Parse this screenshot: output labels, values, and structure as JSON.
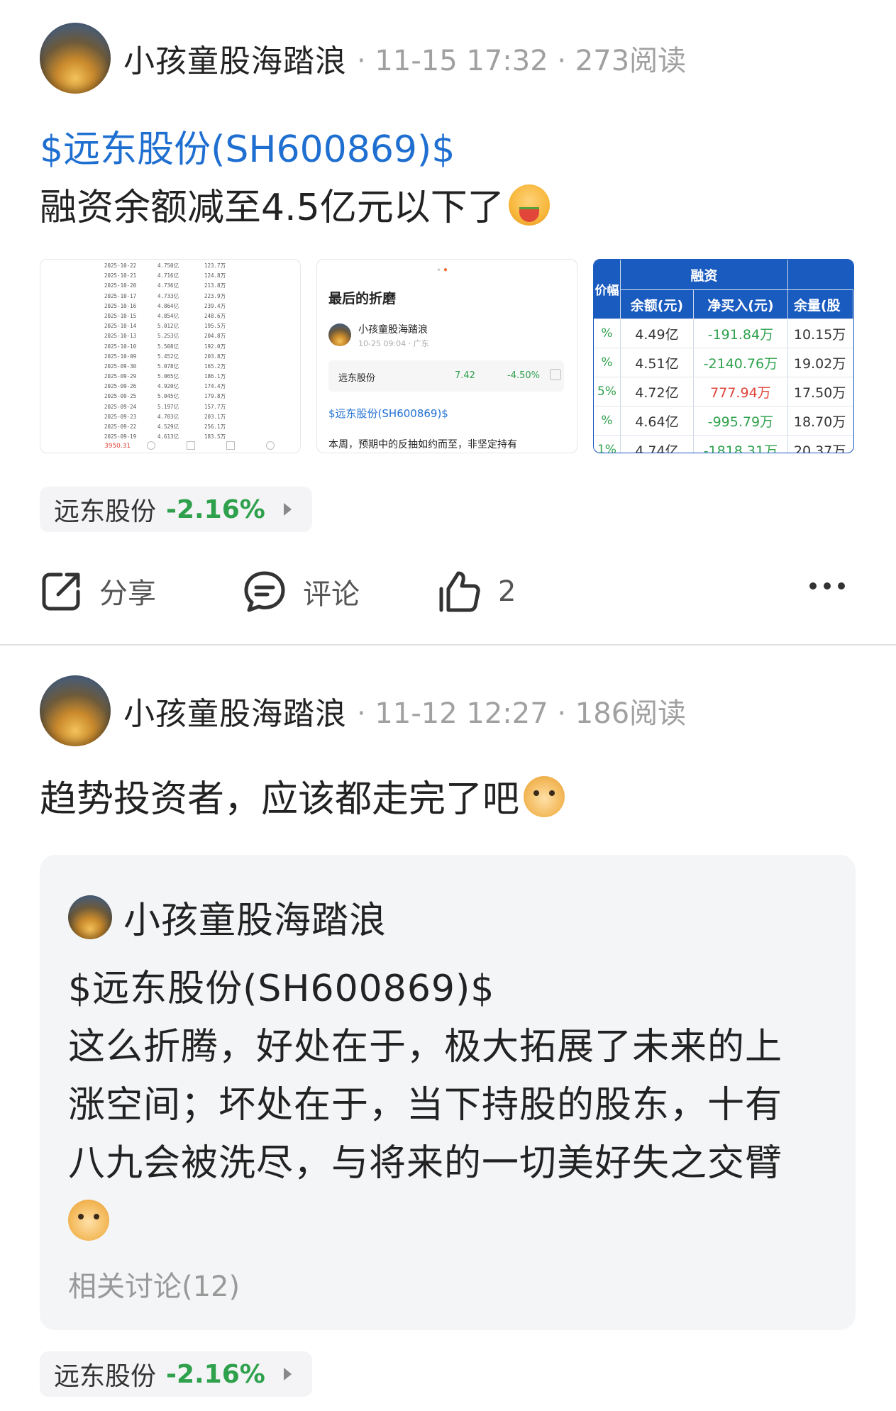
{
  "post1": {
    "author": "小孩童股海踏浪",
    "meta": "· 11-15 17:32 · 273阅读",
    "stock_link": "$远东股份(SH600869)$",
    "text": "融资余额减至4.5亿元以下了",
    "emoji_icon": "watermelon-face-emoji",
    "thumb1": {
      "rows": [
        [
          "2025-10-22",
          "4.750亿",
          "123.7万"
        ],
        [
          "2025-10-21",
          "4.716亿",
          "124.8万"
        ],
        [
          "2025-10-20",
          "4.736亿",
          "213.8万"
        ],
        [
          "2025-10-17",
          "4.733亿",
          "223.9万"
        ],
        [
          "2025-10-16",
          "4.864亿",
          "239.4万"
        ],
        [
          "2025-10-15",
          "4.854亿",
          "248.6万"
        ],
        [
          "2025-10-14",
          "5.012亿",
          "195.5万"
        ],
        [
          "2025-10-13",
          "5.253亿",
          "204.8万"
        ],
        [
          "2025-10-10",
          "5.508亿",
          "192.0万"
        ],
        [
          "2025-10-09",
          "5.452亿",
          "203.8万"
        ],
        [
          "2025-09-30",
          "5.078亿",
          "165.2万"
        ],
        [
          "2025-09-29",
          "5.065亿",
          "186.1万"
        ],
        [
          "2025-09-26",
          "4.920亿",
          "174.4万"
        ],
        [
          "2025-09-25",
          "5.045亿",
          "179.8万"
        ],
        [
          "2025-09-24",
          "5.197亿",
          "157.7万"
        ],
        [
          "2025-09-23",
          "4.703亿",
          "203.1万"
        ],
        [
          "2025-09-22",
          "4.529亿",
          "256.1万"
        ],
        [
          "2025-09-19",
          "4.613亿",
          "183.5万"
        ]
      ],
      "footer_value": "3950.31"
    },
    "thumb2": {
      "title": "最后的折磨",
      "author": "小孩童股海踏浪",
      "sub": "10-25 09:04 · 广东",
      "stock_name": "远东股份",
      "stock_price": "7.42",
      "stock_pct": "-4.50%",
      "link": "$远东股份(SH600869)$",
      "body": "本周，预期中的反抽如约而至，非坚定持有"
    },
    "thumb3": {
      "group_header": "融资",
      "left_header": "价幅",
      "headers": [
        "余额(元)",
        "净买入(元)",
        "余量(股"
      ],
      "rows": [
        {
          "l": "%",
          "bal": "4.49亿",
          "net": "-191.84万",
          "net_color": "#2fa14d",
          "rem": "10.15万"
        },
        {
          "l": "%",
          "bal": "4.51亿",
          "net": "-2140.76万",
          "net_color": "#2fa14d",
          "rem": "19.02万"
        },
        {
          "l": "5%",
          "bal": "4.72亿",
          "net": "777.94万",
          "net_color": "#e0453a",
          "rem": "17.50万"
        },
        {
          "l": "%",
          "bal": "4.64亿",
          "net": "-995.79万",
          "net_color": "#2fa14d",
          "rem": "18.70万"
        },
        {
          "l": "1%",
          "bal": "4.74亿",
          "net": "-1818.31万",
          "net_color": "#2fa14d",
          "rem": "20.37万"
        }
      ]
    },
    "chip": {
      "name": "远东股份",
      "pct": "-2.16%"
    },
    "actions": {
      "share": "分享",
      "comment": "评论",
      "like_count": "2"
    }
  },
  "post2": {
    "author": "小孩童股海踏浪",
    "meta": "· 11-12 12:27 · 186阅读",
    "text": "趋势投资者，应该都走完了吧",
    "emoji_icon": "doge-emoji",
    "quote": {
      "author": "小孩童股海踏浪",
      "stock_link": "$远东股份(SH600869)$",
      "lines": [
        "这么折腾，好处在于，极大拓展了未来的上",
        "涨空间；坏处在于，当下持股的股东，十有",
        "八九会被洗尽，与将来的一切美好失之交臂"
      ],
      "related": "相关讨论(12)"
    },
    "chip": {
      "name": "远东股份",
      "pct": "-2.16%"
    }
  },
  "colors": {
    "link": "#1f6fd1",
    "down": "#2fa14d",
    "up": "#e0453a",
    "table_header": "#1a5bbf"
  }
}
